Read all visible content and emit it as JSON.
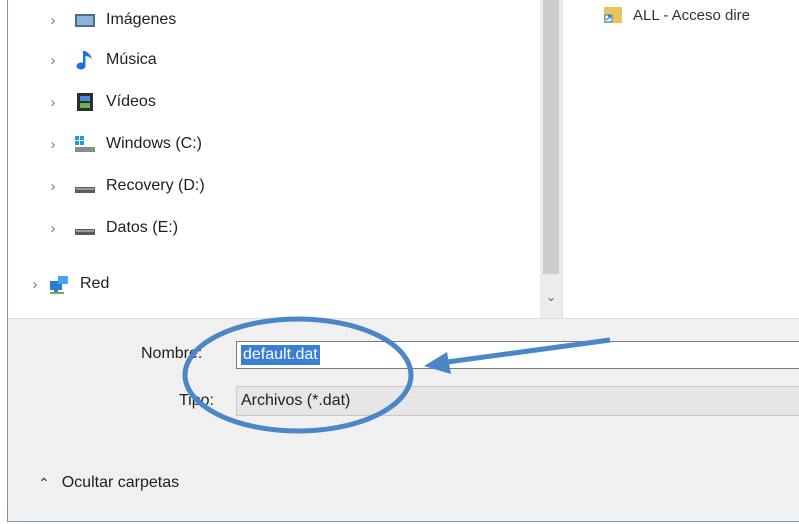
{
  "nav": {
    "items": [
      {
        "label": "Imágenes",
        "icon": "pictures-folder-icon"
      },
      {
        "label": "Música",
        "icon": "music-note-icon"
      },
      {
        "label": "Vídeos",
        "icon": "video-folder-icon"
      },
      {
        "label": "Windows (C:)",
        "icon": "windows-drive-icon"
      },
      {
        "label": "Recovery (D:)",
        "icon": "drive-icon"
      },
      {
        "label": "Datos (E:)",
        "icon": "drive-icon"
      },
      {
        "label": "Red",
        "icon": "network-icon"
      }
    ]
  },
  "files": {
    "items": [
      {
        "label": "ALL - Acceso dire",
        "icon": "shortcut-file-icon"
      }
    ]
  },
  "form": {
    "name_label": "Nombre:",
    "name_value": "default.dat",
    "type_label": "Tipo:",
    "type_value": "Archivos (*.dat)"
  },
  "footer": {
    "toggle_label": "Ocultar carpetas",
    "toggle_icon": "chevron-up-icon"
  },
  "colors": {
    "selection": "#3a7fd5",
    "annotation": "#4a86c8"
  }
}
